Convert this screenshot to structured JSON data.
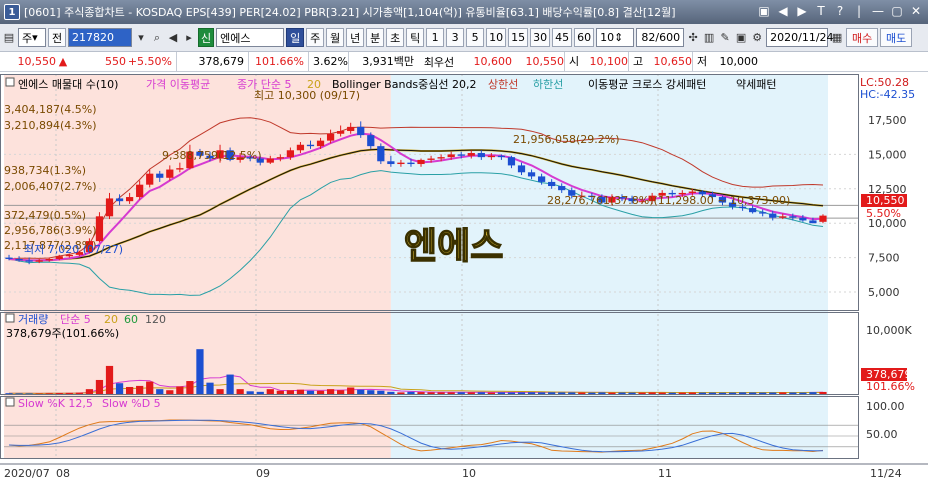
{
  "title_bar": {
    "number": "1",
    "text": "[0601] 주식종합차트 - KOSDAQ EPS[439] PER[24.02] PBR[3.21] 시가총액[1,104(억)] 유통비율[63.1] 배당수익률[0.8] 결산[12월]",
    "icons": [
      "▣",
      "◀",
      "▶",
      "T",
      "?",
      "|",
      "—",
      "▢",
      "✕"
    ]
  },
  "toolbar": {
    "market_select": "주",
    "prev_label": "전",
    "code": "217820",
    "stock_name": "엔에스",
    "credit_badge": "신",
    "periods": [
      "일",
      "주",
      "월",
      "년",
      "분",
      "초",
      "틱"
    ],
    "active_period": "일",
    "intervals": [
      "1",
      "3",
      "5",
      "10",
      "15",
      "30",
      "45",
      "60",
      "10"
    ],
    "count": "82/600",
    "date": "2020/11/24",
    "buy_label": "매수",
    "sell_label": "매도"
  },
  "info_bar": {
    "price": "10,550",
    "change_arrow": "▲",
    "change": "550",
    "change_rate": "+5.50%",
    "volume": "378,679",
    "volume_ratio": "101.66%",
    "turnover": "3.62%",
    "amount": "3,931백만",
    "best_label": "최우선",
    "bid": "10,600",
    "ask": "10,550",
    "open_label": "시",
    "open": "10,100",
    "high_label": "고",
    "high": "10,650",
    "low_label": "저",
    "low": "10,000"
  },
  "price_legend": {
    "item1": "엔에스 매물대 수(10)",
    "item2": "가격 이동평균",
    "item3": "종가 단순 5",
    "item3b": "20",
    "item4": "Bollinger Bands중심선 20,2",
    "item5": "상한선",
    "item6": "하한선",
    "item7": "이동평균 크로스 강세패턴",
    "item8": "약세패턴"
  },
  "price_top_right": {
    "lc": "LC:50.28",
    "hc": "HC:-42.35"
  },
  "volume_profile_labels": [
    "3,404,187(4.5%)",
    "3,210,894(4.3%)",
    "938,734(1.3%)",
    "2,006,407(2.7%)",
    "372,479(0.5%)",
    "2,956,786(3.9%)",
    "2,117,877(2.8%)"
  ],
  "annotations": {
    "high": "최고 10,300 (09/17)",
    "low": "최저 7,020 (07/27)",
    "vp_mid": "9,388,759(12.5%)",
    "vp_upper": "21,956,058(29.2%)",
    "vp_max": "28,276,761(37.8%)(11,298.00 ~ 10,373.00)"
  },
  "watermark": "엔에스",
  "price_axis": {
    "ticks": [
      "17,500",
      "15,000",
      "12,500",
      "10,000",
      "7,500",
      "5,000"
    ],
    "current": "10,550",
    "rate": "5.50%"
  },
  "volume_legend": {
    "item1": "거래량",
    "item2": "단순 5",
    "item3": "20",
    "item4": "60",
    "item5": "120",
    "value": "378,679주(101.66%)"
  },
  "volume_axis": {
    "ticks": [
      "10,000K"
    ],
    "current": "378,679",
    "rate": "101.66%"
  },
  "stoch_legend": {
    "item1": "Slow %K 12,5",
    "item2": "Slow %D 5"
  },
  "stoch_axis": {
    "ticks": [
      "100.00",
      "50.00"
    ]
  },
  "date_axis": {
    "labels": [
      "2020/07",
      "08",
      "09",
      "10",
      "11"
    ],
    "current": "11/24"
  },
  "colors": {
    "up": "#e21a1a",
    "down": "#1c4fd1",
    "ma5": "#d63ad1",
    "ma20": "#c9a21a",
    "bb_mid": "#111111",
    "bb_upper": "#c0392b",
    "bb_lower": "#2aa0a6",
    "shade_red": "#fde2dc",
    "shade_blue": "#e2f3fb"
  },
  "chart_data": {
    "type": "candlestick",
    "series": [
      {
        "name": "엔에스",
        "o": [
          7500,
          7400,
          7300,
          7200,
          7300,
          7400,
          7600,
          7700,
          7900,
          8700,
          10500,
          11800,
          11600,
          11900,
          12800,
          13600,
          13300,
          13900,
          14000,
          15200,
          14900,
          14700,
          15300,
          14600,
          14800,
          14700,
          14400,
          14700,
          14800,
          15300,
          15700,
          15600,
          16000,
          16500,
          16700,
          17000,
          16400,
          15600,
          14500,
          14300,
          14400,
          14300,
          14600,
          14700,
          14800,
          15000,
          14900,
          15100,
          14800,
          14900,
          14800,
          14200,
          13700,
          13400,
          13000,
          12700,
          12400,
          12000,
          12000,
          11900,
          11500,
          11900,
          11800,
          11600,
          11600,
          12000,
          12200,
          12100,
          12200,
          12300,
          12100,
          11900,
          11500,
          11200,
          11100,
          10800,
          10700,
          10400,
          10500,
          10400,
          10200,
          10100
        ],
        "c": [
          7400,
          7300,
          7200,
          7300,
          7400,
          7600,
          7700,
          7900,
          8700,
          10500,
          11800,
          11600,
          11900,
          12800,
          13600,
          13300,
          13900,
          14000,
          15200,
          14900,
          14700,
          15300,
          14600,
          14800,
          14700,
          14400,
          14700,
          14800,
          15300,
          15700,
          15600,
          16000,
          16500,
          16700,
          17000,
          16400,
          15600,
          14500,
          14300,
          14400,
          14300,
          14600,
          14700,
          14800,
          15000,
          14900,
          15100,
          14800,
          14900,
          14800,
          14200,
          13700,
          13400,
          13000,
          12700,
          12400,
          12000,
          12000,
          11900,
          11500,
          11900,
          11800,
          11600,
          11600,
          12000,
          12200,
          12100,
          12200,
          12300,
          12100,
          11900,
          11500,
          11200,
          11100,
          10800,
          10700,
          10400,
          10500,
          10400,
          10200,
          10000,
          10550
        ],
        "h": [
          7700,
          7600,
          7500,
          7400,
          7500,
          7700,
          7800,
          8000,
          8900,
          10800,
          12200,
          12100,
          12200,
          13100,
          13900,
          13800,
          14200,
          14400,
          15700,
          15400,
          15200,
          15700,
          15500,
          15100,
          15000,
          14900,
          14900,
          15000,
          15500,
          15900,
          16000,
          16200,
          16800,
          17100,
          17300,
          17400,
          16600,
          15800,
          14900,
          14600,
          14700,
          14700,
          14900,
          15000,
          15200,
          15200,
          15300,
          15300,
          15100,
          15000,
          14900,
          14400,
          13900,
          13600,
          13200,
          12900,
          12600,
          12300,
          12200,
          12100,
          12100,
          12100,
          12000,
          11800,
          12200,
          12400,
          12400,
          12400,
          12500,
          12400,
          12300,
          12000,
          11700,
          11400,
          11300,
          11000,
          10900,
          10700,
          10700,
          10600,
          10400,
          10650
        ],
        "l": [
          7300,
          7200,
          7020,
          7100,
          7200,
          7300,
          7500,
          7600,
          7800,
          8600,
          10300,
          11300,
          11400,
          11700,
          12600,
          13000,
          13100,
          13700,
          13900,
          14700,
          14500,
          14400,
          14500,
          14400,
          14500,
          14200,
          14300,
          14500,
          14600,
          15100,
          15400,
          15400,
          15800,
          16300,
          16500,
          16200,
          15400,
          14300,
          14100,
          14100,
          14100,
          14100,
          14400,
          14500,
          14600,
          14700,
          14700,
          14600,
          14600,
          14600,
          14000,
          13500,
          13200,
          12800,
          12500,
          12200,
          11800,
          11800,
          11700,
          11400,
          11300,
          11600,
          11400,
          11400,
          11400,
          11800,
          11900,
          11900,
          12000,
          11900,
          11700,
          11300,
          11000,
          10900,
          10700,
          10500,
          10200,
          10300,
          10200,
          10100,
          10000,
          10000
        ]
      },
      {
        "name": "거래량",
        "values": [
          150,
          120,
          110,
          100,
          140,
          180,
          210,
          260,
          900,
          2600,
          5200,
          2000,
          1300,
          1500,
          2300,
          900,
          700,
          1400,
          2400,
          8300,
          2100,
          900,
          3600,
          900,
          500,
          400,
          900,
          600,
          700,
          800,
          600,
          600,
          900,
          700,
          1200,
          800,
          700,
          600,
          400,
          300,
          400,
          350,
          300,
          300,
          300,
          320,
          300,
          320,
          260,
          300,
          280,
          300,
          320,
          300,
          320,
          300,
          300,
          280,
          260,
          300,
          260,
          280,
          260,
          260,
          300,
          260,
          240,
          260,
          280,
          260,
          260,
          240,
          260,
          300,
          280,
          260,
          280,
          300,
          280,
          260,
          340,
          380
        ]
      }
    ],
    "price_ylim": [
      5000,
      17500
    ],
    "volume_ylim": [
      0,
      10000
    ],
    "stoch_ylim": [
      0,
      100
    ]
  }
}
